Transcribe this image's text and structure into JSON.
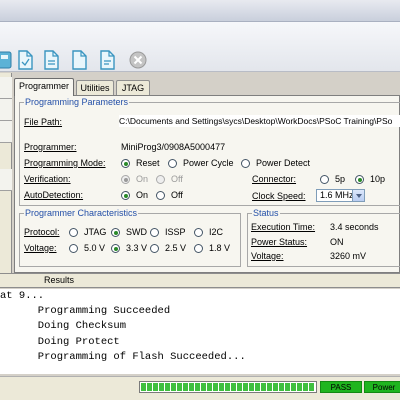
{
  "toolbar": {
    "icons": [
      "document-save-icon",
      "document-icon",
      "document-icon",
      "document-icon",
      "stop-icon"
    ]
  },
  "tabs": [
    {
      "label": "Programmer",
      "active": true
    },
    {
      "label": "Utilities",
      "active": false
    },
    {
      "label": "JTAG",
      "active": false
    }
  ],
  "programming_parameters": {
    "legend": "Programming Parameters",
    "file_path_label": "File Path:",
    "file_path_value": "C:\\Documents and Settings\\sycs\\Desktop\\WorkDocs\\PSoC Training\\PSo",
    "programmer_label": "Programmer:",
    "programmer_value": "MiniProg3/0908A5000477",
    "programming_mode_label": "Programming Mode:",
    "programming_mode_options": [
      "Reset",
      "Power Cycle",
      "Power Detect"
    ],
    "programming_mode_selected": "Reset",
    "verification_label": "Verification:",
    "verification_options": [
      "On",
      "Off"
    ],
    "verification_selected": "On",
    "autodetection_label": "AutoDetection:",
    "autodetection_options": [
      "On",
      "Off"
    ],
    "autodetection_selected": "On",
    "connector_label": "Connector:",
    "connector_options": [
      "5p",
      "10p"
    ],
    "connector_selected": "10p",
    "clock_speed_label": "Clock Speed:",
    "clock_speed_value": "1.6 MHz"
  },
  "programmer_characteristics": {
    "legend": "Programmer Characteristics",
    "protocol_label": "Protocol:",
    "protocol_options": [
      "JTAG",
      "SWD",
      "ISSP",
      "I2C"
    ],
    "protocol_selected": "SWD",
    "voltage_label": "Voltage:",
    "voltage_options": [
      "5.0 V",
      "3.3 V",
      "2.5 V",
      "1.8 V"
    ],
    "voltage_selected": "3.3 V"
  },
  "status": {
    "legend": "Status",
    "execution_time_label": "Execution Time:",
    "execution_time_value": "3.4 seconds",
    "power_status_label": "Power Status:",
    "power_status_value": "ON",
    "voltage_label": "Voltage:",
    "voltage_value": "3260 mV"
  },
  "results": {
    "tab_label": "Results",
    "lines": [
      "at 9...",
      "      Programming Succeeded",
      "      Doing Checksum",
      "      Doing Protect",
      "      Programming of Flash Succeeded..."
    ]
  },
  "statusbar": {
    "progress": 1.0,
    "pass_label": "PASS",
    "power_label": "Power"
  },
  "colors": {
    "legend_text": "#2450a8",
    "pass_green": "#1fb51f",
    "progress_green": "#3fbf3f"
  }
}
